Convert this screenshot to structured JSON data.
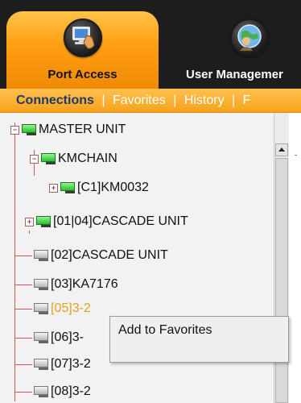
{
  "tabs": [
    {
      "label": "Port Access",
      "icon": "computer-hand-icon",
      "active": true
    },
    {
      "label": "User Managemer",
      "icon": "user-globe-icon",
      "active": false
    }
  ],
  "subnav": {
    "items": [
      "Connections",
      "Favorites",
      "History",
      "F"
    ],
    "separator": "|",
    "active": "Connections"
  },
  "tree": {
    "nodes": [
      {
        "label": "MASTER UNIT",
        "status": "online",
        "expandable": true
      },
      {
        "label": "KMCHAIN",
        "status": "online",
        "expandable": true
      },
      {
        "label": "[C1]KM0032",
        "status": "online",
        "expandable": true
      },
      {
        "label": "[01|04]CASCADE UNIT",
        "status": "online",
        "expandable": true
      },
      {
        "label": "[02]CASCADE UNIT",
        "status": "offline",
        "expandable": false
      },
      {
        "label": "[03]KA7176",
        "status": "offline",
        "expandable": false
      },
      {
        "label": "[05]3-2",
        "status": "offline",
        "expandable": false,
        "selected": true
      },
      {
        "label": "[06]3-",
        "status": "offline",
        "expandable": false
      },
      {
        "label": "[07]3-2",
        "status": "offline",
        "expandable": false
      },
      {
        "label": "[08]3-2",
        "status": "offline",
        "expandable": false
      }
    ]
  },
  "context_menu": {
    "items": [
      "Add to Favorites"
    ]
  },
  "colors": {
    "accent_orange": "#f7a21c",
    "selected_text": "#e0a020",
    "subnav_active": "#1d3a6a",
    "topbar_bg": "#1d1d1d",
    "tree_bg": "#f2f2f2"
  }
}
